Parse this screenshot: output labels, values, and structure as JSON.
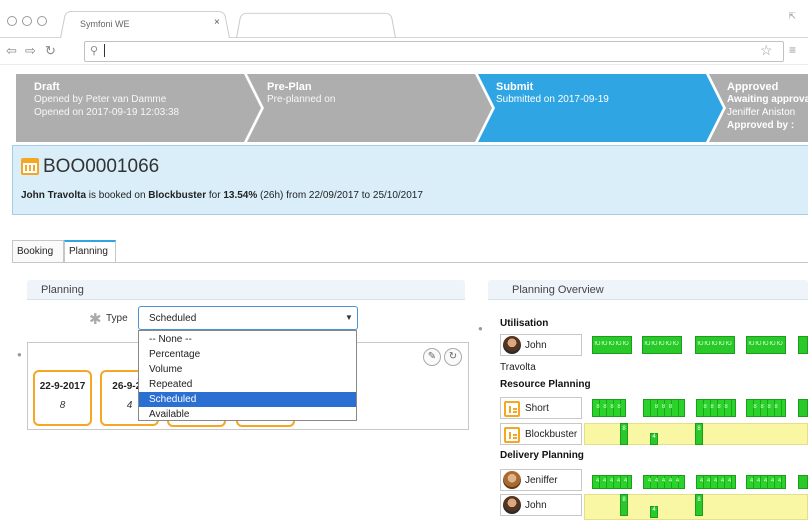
{
  "browser": {
    "tab_title": "Symfoni WE",
    "tab_close": "×"
  },
  "workflow": {
    "steps": [
      {
        "label": "Draft",
        "lines": [
          "Opened by Peter van Damme",
          "Opened on 2017-09-19 12:03:38"
        ],
        "state": "done"
      },
      {
        "label": "Pre-Plan",
        "lines": [
          "Pre-planned on"
        ],
        "state": "done"
      },
      {
        "label": "Submit",
        "lines": [
          "Submitted on 2017-09-19"
        ],
        "state": "active"
      },
      {
        "label": "Approved",
        "lines": [
          "Awaiting approva",
          "Jeniffer Aniston",
          "Approved by :"
        ],
        "state": "pending"
      }
    ]
  },
  "booking": {
    "id": "BOO0001066",
    "resource": "John Travolta",
    "text_booked_on": "is booked on",
    "project": "Blockbuster",
    "text_for": "for",
    "percentage": "13.54%",
    "text_rest": "(26h) from 22/09/2017 to 25/10/2017"
  },
  "tabs": {
    "booking": "Booking",
    "planning": "Planning"
  },
  "planning": {
    "title": "Planning",
    "type_label": "Type",
    "type_value": "Scheduled",
    "type_options": [
      "-- None --",
      "Percentage",
      "Volume",
      "Repeated",
      "Scheduled",
      "Available"
    ],
    "selected_index": 4,
    "cards": [
      {
        "date": "22-9-2017",
        "hours": "8"
      },
      {
        "date": "26-9-20",
        "hours": "4"
      }
    ]
  },
  "overview": {
    "title": "Planning Overview",
    "utilisation_label": "Utilisation",
    "resource_planning_label": "Resource Planning",
    "delivery_planning_label": "Delivery Planning",
    "utilisation_person_first": "John",
    "utilisation_person_last": "Travolta",
    "resource_rows": [
      "Short",
      "Blockbuster"
    ],
    "delivery_rows": [
      "Jeniffer",
      "John"
    ],
    "bar_text_util": "ЮЮЮЮЮ",
    "bar_text_short": "8 8 8 8",
    "bar_text_short_split": "8 8 8",
    "bar_text_jeniffer": "4 4 4 4 4",
    "mini_8": "8",
    "mini_4": "4"
  },
  "colors": {
    "accent": "#2fa5e3",
    "step_pending": "#aeaeae",
    "card_border": "#f5a623",
    "bar_green": "#29c929",
    "lane_yellow": "#faf7a4"
  }
}
